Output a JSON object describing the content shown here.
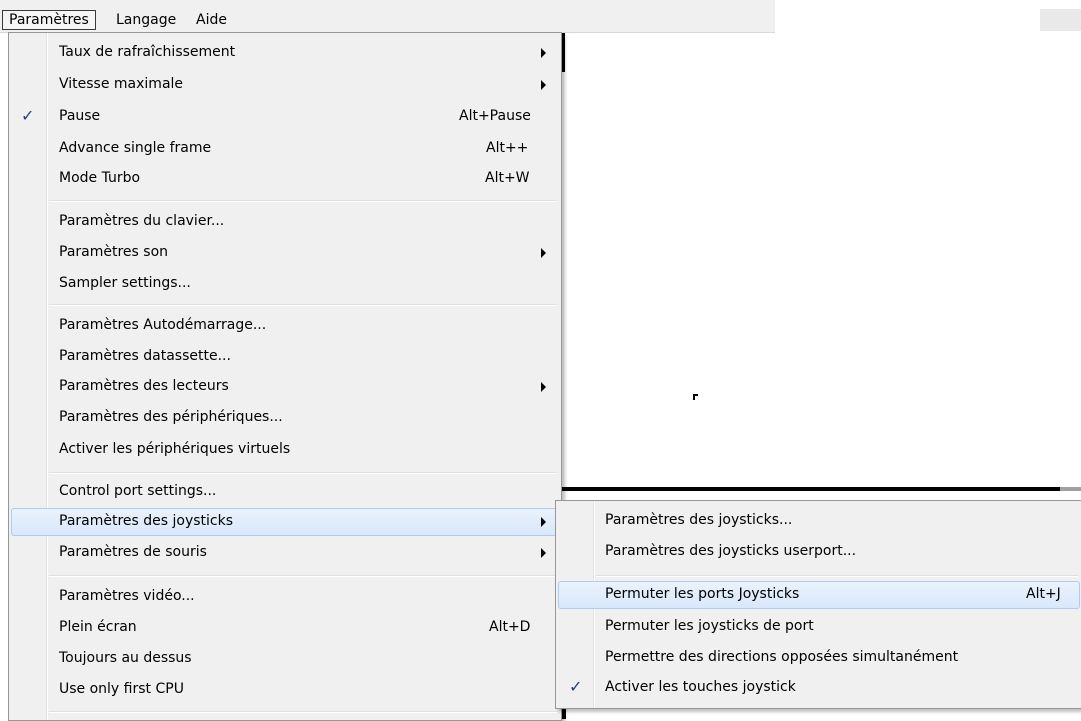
{
  "menubar": {
    "items": [
      "Paramètres",
      "Langage",
      "Aide"
    ]
  },
  "main_menu": {
    "items": [
      {
        "label": "Taux de rafraîchissement",
        "shortcut": "",
        "submenu": true,
        "checked": false
      },
      {
        "label": "Vitesse maximale",
        "shortcut": "",
        "submenu": true,
        "checked": false
      },
      {
        "label": "Pause",
        "shortcut": "Alt+Pause",
        "submenu": false,
        "checked": true
      },
      {
        "label": "Advance single frame",
        "shortcut": "Alt++",
        "submenu": false,
        "checked": false
      },
      {
        "label": "Mode Turbo",
        "shortcut": "Alt+W",
        "submenu": false,
        "checked": false
      },
      {
        "label": "Paramètres du clavier...",
        "shortcut": "",
        "submenu": false,
        "checked": false
      },
      {
        "label": "Paramètres son",
        "shortcut": "",
        "submenu": true,
        "checked": false
      },
      {
        "label": "Sampler settings...",
        "shortcut": "",
        "submenu": false,
        "checked": false
      },
      {
        "label": "Paramètres Autodémarrage...",
        "shortcut": "",
        "submenu": false,
        "checked": false
      },
      {
        "label": "Paramètres datassette...",
        "shortcut": "",
        "submenu": false,
        "checked": false
      },
      {
        "label": "Paramètres des lecteurs",
        "shortcut": "",
        "submenu": true,
        "checked": false
      },
      {
        "label": "Paramètres des périphériques...",
        "shortcut": "",
        "submenu": false,
        "checked": false
      },
      {
        "label": "Activer les périphériques virtuels",
        "shortcut": "",
        "submenu": false,
        "checked": false
      },
      {
        "label": "Control port settings...",
        "shortcut": "",
        "submenu": false,
        "checked": false
      },
      {
        "label": "Paramètres des joysticks",
        "shortcut": "",
        "submenu": true,
        "checked": false,
        "highlighted": true
      },
      {
        "label": "Paramètres de souris",
        "shortcut": "",
        "submenu": true,
        "checked": false
      },
      {
        "label": "Paramètres vidéo...",
        "shortcut": "",
        "submenu": false,
        "checked": false
      },
      {
        "label": "Plein écran",
        "shortcut": "Alt+D",
        "submenu": false,
        "checked": false
      },
      {
        "label": "Toujours au dessus",
        "shortcut": "",
        "submenu": false,
        "checked": false
      },
      {
        "label": "Use only first CPU",
        "shortcut": "",
        "submenu": false,
        "checked": false
      }
    ]
  },
  "joystick_submenu": {
    "items": [
      {
        "label": "Paramètres des joysticks...",
        "shortcut": "",
        "checked": false
      },
      {
        "label": "Paramètres des joysticks userport...",
        "shortcut": "",
        "checked": false
      },
      {
        "label": "Permuter les ports Joysticks",
        "shortcut": "Alt+J",
        "checked": false,
        "highlighted": true
      },
      {
        "label": "Permuter les joysticks de port",
        "shortcut": "",
        "checked": false
      },
      {
        "label": "Permettre des directions opposées simultanément",
        "shortcut": "",
        "checked": false
      },
      {
        "label": "Activer les touches joystick",
        "shortcut": "",
        "checked": true
      }
    ]
  },
  "icons": {
    "check": "✓",
    "submenu_arrow": "chevron-right-icon"
  }
}
